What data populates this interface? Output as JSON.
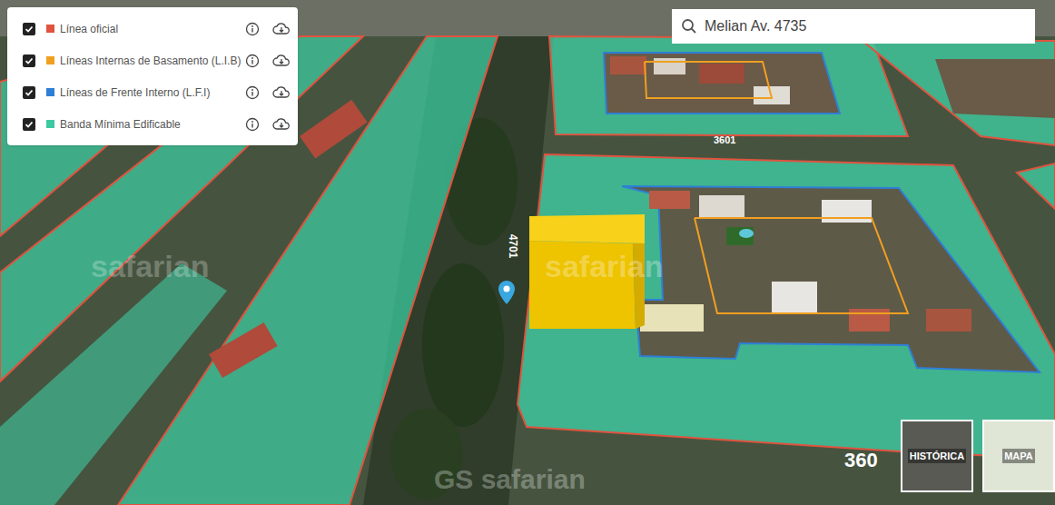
{
  "legend": {
    "layers": [
      {
        "label": "Línea oficial",
        "checked": true,
        "color": "#e0533f"
      },
      {
        "label": "Líneas Internas de Basamento (L.I.B)",
        "checked": true,
        "color": "#f0a020"
      },
      {
        "label": "Líneas de Frente Interno (L.F.I)",
        "checked": true,
        "color": "#2f7fd6"
      },
      {
        "label": "Banda Mínima Edificable",
        "checked": true,
        "color": "#3ec9a0"
      }
    ]
  },
  "search": {
    "value": "Melian Av. 4735"
  },
  "map": {
    "street_labels": [
      "4701",
      "3601",
      "360"
    ],
    "watermarks": [
      "safarian",
      "safarian",
      "GS safarian"
    ]
  },
  "basemaps": [
    {
      "label": "HISTÓRICA"
    },
    {
      "label": "MAPA"
    }
  ]
}
